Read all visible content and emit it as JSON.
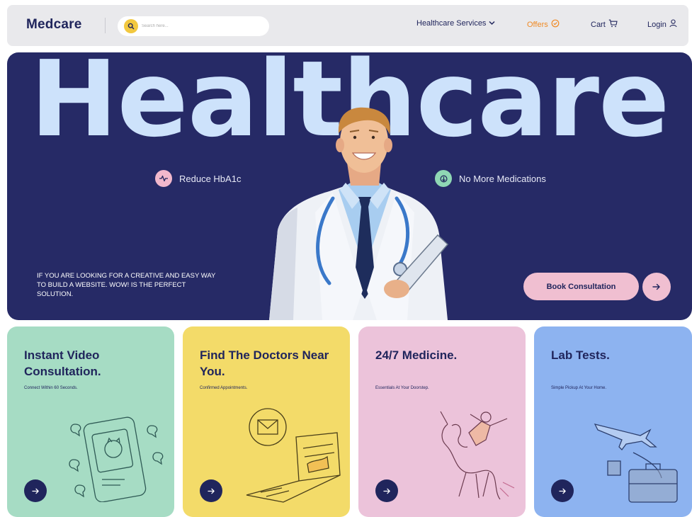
{
  "nav": {
    "logo": "Medcare",
    "search_placeholder": "Search here...",
    "links": {
      "services": "Healthcare Services",
      "offers": "Offers",
      "cart": "Cart",
      "login": "Login"
    }
  },
  "hero": {
    "title": "Healthcare",
    "features": [
      {
        "label": "Reduce HbA1c",
        "icon": "pulse-icon"
      },
      {
        "label": "No More Medications",
        "icon": "pill-icon"
      }
    ],
    "description": "IF YOU ARE LOOKING FOR A CREATIVE AND EASY WAY TO BUILD A WEBSITE. WOW! IS THE PERFECT SOLUTION.",
    "cta_label": "Book Consultation"
  },
  "cards": [
    {
      "title": "Instant Video Consultation.",
      "subtitle": "Connect Within 60 Seconds."
    },
    {
      "title": "Find The Doctors Near You.",
      "subtitle": "Confirmed Appointments."
    },
    {
      "title": "24/7 Medicine.",
      "subtitle": "Essentials At Your Doorstep."
    },
    {
      "title": "Lab Tests.",
      "subtitle": "Simple Pickup At Your Home."
    }
  ],
  "colors": {
    "navy": "#20255c",
    "hero_bg": "#262a66",
    "hero_title": "#cde2fb",
    "accent_pink": "#f0bfd1",
    "accent_orange": "#f08a24",
    "card_green": "#a6dcc4",
    "card_yellow": "#f3db69",
    "card_pink": "#ecc3da",
    "card_blue": "#8db3f0"
  }
}
